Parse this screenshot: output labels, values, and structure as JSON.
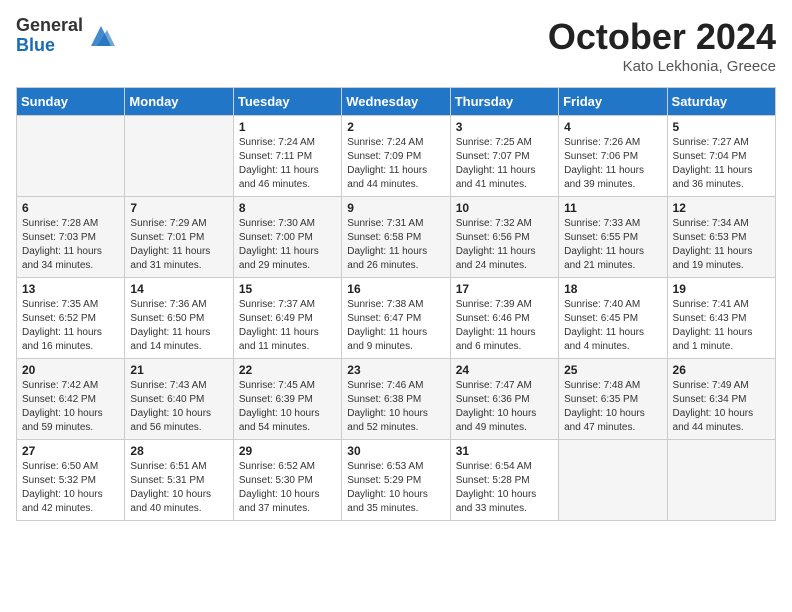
{
  "header": {
    "logo_general": "General",
    "logo_blue": "Blue",
    "month_title": "October 2024",
    "location": "Kato Lekhonia, Greece"
  },
  "days_of_week": [
    "Sunday",
    "Monday",
    "Tuesday",
    "Wednesday",
    "Thursday",
    "Friday",
    "Saturday"
  ],
  "weeks": [
    [
      {
        "day": "",
        "info": ""
      },
      {
        "day": "",
        "info": ""
      },
      {
        "day": "1",
        "info": "Sunrise: 7:24 AM\nSunset: 7:11 PM\nDaylight: 11 hours and 46 minutes."
      },
      {
        "day": "2",
        "info": "Sunrise: 7:24 AM\nSunset: 7:09 PM\nDaylight: 11 hours and 44 minutes."
      },
      {
        "day": "3",
        "info": "Sunrise: 7:25 AM\nSunset: 7:07 PM\nDaylight: 11 hours and 41 minutes."
      },
      {
        "day": "4",
        "info": "Sunrise: 7:26 AM\nSunset: 7:06 PM\nDaylight: 11 hours and 39 minutes."
      },
      {
        "day": "5",
        "info": "Sunrise: 7:27 AM\nSunset: 7:04 PM\nDaylight: 11 hours and 36 minutes."
      }
    ],
    [
      {
        "day": "6",
        "info": "Sunrise: 7:28 AM\nSunset: 7:03 PM\nDaylight: 11 hours and 34 minutes."
      },
      {
        "day": "7",
        "info": "Sunrise: 7:29 AM\nSunset: 7:01 PM\nDaylight: 11 hours and 31 minutes."
      },
      {
        "day": "8",
        "info": "Sunrise: 7:30 AM\nSunset: 7:00 PM\nDaylight: 11 hours and 29 minutes."
      },
      {
        "day": "9",
        "info": "Sunrise: 7:31 AM\nSunset: 6:58 PM\nDaylight: 11 hours and 26 minutes."
      },
      {
        "day": "10",
        "info": "Sunrise: 7:32 AM\nSunset: 6:56 PM\nDaylight: 11 hours and 24 minutes."
      },
      {
        "day": "11",
        "info": "Sunrise: 7:33 AM\nSunset: 6:55 PM\nDaylight: 11 hours and 21 minutes."
      },
      {
        "day": "12",
        "info": "Sunrise: 7:34 AM\nSunset: 6:53 PM\nDaylight: 11 hours and 19 minutes."
      }
    ],
    [
      {
        "day": "13",
        "info": "Sunrise: 7:35 AM\nSunset: 6:52 PM\nDaylight: 11 hours and 16 minutes."
      },
      {
        "day": "14",
        "info": "Sunrise: 7:36 AM\nSunset: 6:50 PM\nDaylight: 11 hours and 14 minutes."
      },
      {
        "day": "15",
        "info": "Sunrise: 7:37 AM\nSunset: 6:49 PM\nDaylight: 11 hours and 11 minutes."
      },
      {
        "day": "16",
        "info": "Sunrise: 7:38 AM\nSunset: 6:47 PM\nDaylight: 11 hours and 9 minutes."
      },
      {
        "day": "17",
        "info": "Sunrise: 7:39 AM\nSunset: 6:46 PM\nDaylight: 11 hours and 6 minutes."
      },
      {
        "day": "18",
        "info": "Sunrise: 7:40 AM\nSunset: 6:45 PM\nDaylight: 11 hours and 4 minutes."
      },
      {
        "day": "19",
        "info": "Sunrise: 7:41 AM\nSunset: 6:43 PM\nDaylight: 11 hours and 1 minute."
      }
    ],
    [
      {
        "day": "20",
        "info": "Sunrise: 7:42 AM\nSunset: 6:42 PM\nDaylight: 10 hours and 59 minutes."
      },
      {
        "day": "21",
        "info": "Sunrise: 7:43 AM\nSunset: 6:40 PM\nDaylight: 10 hours and 56 minutes."
      },
      {
        "day": "22",
        "info": "Sunrise: 7:45 AM\nSunset: 6:39 PM\nDaylight: 10 hours and 54 minutes."
      },
      {
        "day": "23",
        "info": "Sunrise: 7:46 AM\nSunset: 6:38 PM\nDaylight: 10 hours and 52 minutes."
      },
      {
        "day": "24",
        "info": "Sunrise: 7:47 AM\nSunset: 6:36 PM\nDaylight: 10 hours and 49 minutes."
      },
      {
        "day": "25",
        "info": "Sunrise: 7:48 AM\nSunset: 6:35 PM\nDaylight: 10 hours and 47 minutes."
      },
      {
        "day": "26",
        "info": "Sunrise: 7:49 AM\nSunset: 6:34 PM\nDaylight: 10 hours and 44 minutes."
      }
    ],
    [
      {
        "day": "27",
        "info": "Sunrise: 6:50 AM\nSunset: 5:32 PM\nDaylight: 10 hours and 42 minutes."
      },
      {
        "day": "28",
        "info": "Sunrise: 6:51 AM\nSunset: 5:31 PM\nDaylight: 10 hours and 40 minutes."
      },
      {
        "day": "29",
        "info": "Sunrise: 6:52 AM\nSunset: 5:30 PM\nDaylight: 10 hours and 37 minutes."
      },
      {
        "day": "30",
        "info": "Sunrise: 6:53 AM\nSunset: 5:29 PM\nDaylight: 10 hours and 35 minutes."
      },
      {
        "day": "31",
        "info": "Sunrise: 6:54 AM\nSunset: 5:28 PM\nDaylight: 10 hours and 33 minutes."
      },
      {
        "day": "",
        "info": ""
      },
      {
        "day": "",
        "info": ""
      }
    ]
  ]
}
